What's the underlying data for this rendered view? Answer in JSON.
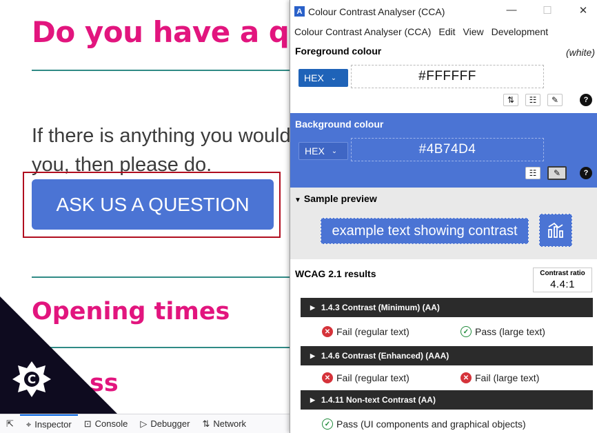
{
  "web": {
    "heading": "Do you have a question?",
    "paragraph_line1": "If there is anything you would like to ask",
    "paragraph_line2": "you, then please do.",
    "ask_button": "ASK US A QUESTION",
    "opening_times": "Opening times",
    "address_partial": "ss"
  },
  "devtools": {
    "inspector": "Inspector",
    "console": "Console",
    "debugger": "Debugger",
    "network": "Network"
  },
  "cca": {
    "title": "Colour Contrast Analyser (CCA)",
    "menu": [
      "Colour Contrast Analyser (CCA)",
      "Edit",
      "View",
      "Development"
    ],
    "foreground": {
      "label": "Foreground colour",
      "note": "(white)",
      "format": "HEX",
      "value": "#FFFFFF"
    },
    "background": {
      "label": "Background colour",
      "format": "HEX",
      "value": "#4B74D4"
    },
    "preview": {
      "title": "Sample preview",
      "text": "example text showing contrast"
    },
    "results": {
      "title": "WCAG 2.1 results",
      "ratio_label": "Contrast ratio",
      "ratio_value": "4.4:1",
      "criteria": [
        {
          "label": "1.4.3 Contrast (Minimum) (AA)",
          "left": "Fail (regular text)",
          "right": "Pass (large text)"
        },
        {
          "label": "1.4.6 Contrast (Enhanced) (AAA)",
          "left": "Fail (regular text)",
          "right": "Fail (large text)"
        },
        {
          "label": "1.4.11 Non-text Contrast (AA)",
          "left": "Pass (UI components and graphical objects)"
        }
      ]
    }
  },
  "colors": {
    "brand_pink": "#e2157e",
    "teal_rule": "#2f8a85",
    "button_blue": "#4b74d4",
    "fail_red": "#d5333a",
    "pass_green": "#1f8a3a"
  }
}
